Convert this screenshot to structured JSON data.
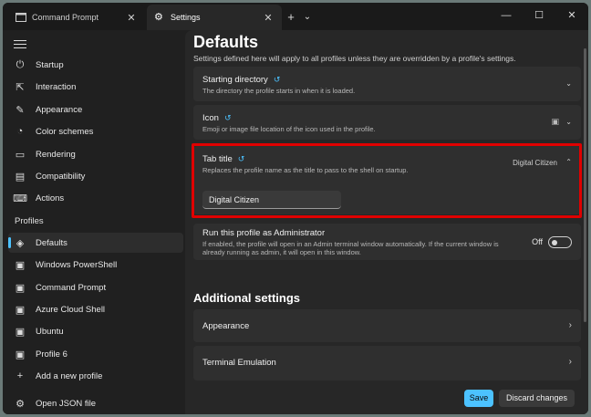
{
  "tabs": [
    {
      "label": "Command Prompt",
      "icon": "terminal-icon"
    },
    {
      "label": "Settings",
      "icon": "gear-icon"
    }
  ],
  "tab_controls": {
    "new_tab": "+",
    "dropdown": "⌄"
  },
  "window_controls": {
    "minimize": "—",
    "maximize": "☐",
    "close": "✕"
  },
  "sidebar": {
    "items": [
      {
        "label": "Startup",
        "icon": "startup-icon"
      },
      {
        "label": "Interaction",
        "icon": "interaction-icon"
      },
      {
        "label": "Appearance",
        "icon": "brush-icon"
      },
      {
        "label": "Color schemes",
        "icon": "palette-icon"
      },
      {
        "label": "Rendering",
        "icon": "monitor-icon"
      },
      {
        "label": "Compatibility",
        "icon": "compatibility-icon"
      },
      {
        "label": "Actions",
        "icon": "keyboard-icon"
      }
    ],
    "profiles_label": "Profiles",
    "profiles": [
      {
        "label": "Defaults",
        "icon": "layers-icon",
        "selected": true
      },
      {
        "label": "Windows PowerShell",
        "icon": "terminal-icon"
      },
      {
        "label": "Command Prompt",
        "icon": "terminal-icon"
      },
      {
        "label": "Azure Cloud Shell",
        "icon": "terminal-icon"
      },
      {
        "label": "Ubuntu",
        "icon": "terminal-icon"
      },
      {
        "label": "Profile 6",
        "icon": "terminal-icon"
      },
      {
        "label": "Add a new profile",
        "icon": "plus-icon"
      }
    ],
    "json_label": "Open JSON file"
  },
  "main": {
    "title": "Defaults",
    "description": "Settings defined here will apply to all profiles unless they are overridden by a profile's settings.",
    "starting_directory": {
      "title": "Starting directory",
      "desc": "The directory the profile starts in when it is loaded."
    },
    "icon_setting": {
      "title": "Icon",
      "desc": "Emoji or image file location of the icon used in the profile."
    },
    "tab_title": {
      "title": "Tab title",
      "desc": "Replaces the profile name as the title to pass to the shell on startup.",
      "value": "Digital Citizen",
      "input_value": "Digital Citizen"
    },
    "run_as_admin": {
      "title": "Run this profile as Administrator",
      "desc_line1": "If enabled, the profile will open in an Admin terminal window automatically. If the current window is",
      "desc_line2": "already running as admin, it will open in this window.",
      "toggle_label": "Off"
    },
    "additional_title": "Additional settings",
    "additional": [
      {
        "label": "Appearance"
      },
      {
        "label": "Terminal Emulation"
      }
    ]
  },
  "footer": {
    "save": "Save",
    "discard": "Discard changes"
  },
  "colors": {
    "accent": "#4cc2ff",
    "highlight": "#e00000"
  }
}
